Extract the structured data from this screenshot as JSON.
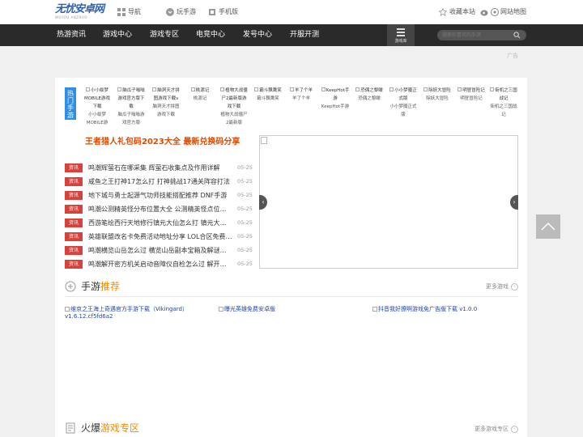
{
  "logo": {
    "main": "无忧安卓网",
    "sub": "WUYOU ANZHUO"
  },
  "toplinks": {
    "nav": "导航",
    "play": "玩手游",
    "phone": "手机版",
    "fav": "收藏本站",
    "sitemap": "网站地图"
  },
  "nav": {
    "items": [
      "热游资讯",
      "游戏中心",
      "游戏专区",
      "电竞中心",
      "发号中心",
      "开服开测"
    ],
    "game_lib": "游戏库"
  },
  "search": {
    "placeholder": "搜索你喜欢的手游"
  },
  "ad_label": "广告",
  "hot": {
    "tag": "热门手游",
    "items": [
      {
        "t1": "小小蚁梦MOBILE游戏下载",
        "t2": "小小蚁梦MOBILE游"
      },
      {
        "t1": "脑瓜子嗡嗡游戏官方版下载",
        "t2": "脑瓜子嗡嗡游戏官方版"
      },
      {
        "t1": "脑洞天才拼图游戏下载v",
        "t2": "脑洞天才拼图游戏下载"
      },
      {
        "t1": "桃源记",
        "t2": "桃源记"
      },
      {
        "t1": "植物大战僵尸2最新版游戏下载",
        "t2": "植物大战僵尸2最新版"
      },
      {
        "t1": "霸斗飘鹰笑",
        "t2": "霸斗飘鹰笑"
      },
      {
        "t1": "羊了个羊",
        "t2": "羊了个羊"
      },
      {
        "t1": "KeepHot手游",
        "t2": "KeepHot手游"
      },
      {
        "t1": "恐偶之黎瞰",
        "t2": "恐偶之黎瞰"
      },
      {
        "t1": "小小梦魇正式版",
        "t2": "小小梦魇正式版"
      },
      {
        "t1": "除妖大冒险",
        "t2": "除妖大冒险"
      },
      {
        "t1": "明昼冒险记",
        "t2": "明昼冒险记"
      },
      {
        "t1": "街机之三国战记",
        "t2": "街机之三国战记"
      }
    ]
  },
  "headline": "王者猎人礼包码2023大全 最新兑换码分享",
  "news": [
    {
      "tag": "资讯",
      "title": "鸣潮辉萤石在哪采集 辉萤石收集点及作用详解",
      "date": "05-25"
    },
    {
      "tag": "资讯",
      "title": "咸鱼之王打神17怎么打 打神挑战17通关阵容打法",
      "date": "05-25"
    },
    {
      "tag": "资讯",
      "title": "地下城与勇士起源气功师技能搭配推荐 DNF手游",
      "date": "05-25"
    },
    {
      "tag": "资讯",
      "title": "鸣潮公测精英怪分布位置大全 公测精英怪点位一览",
      "date": "05-25"
    },
    {
      "tag": "资讯",
      "title": "西游笔绘西行天地修行镇元大仙怎么打 镇元大仙打法",
      "date": "05-25"
    },
    {
      "tag": "资讯",
      "title": "英雄联盟改名卡免费活动地址分享 LOL合区免费改名",
      "date": "05-25"
    },
    {
      "tag": "资讯",
      "title": "鸣潮横览山岳怎么过 横览山岳副本宝箱及解谜攻略",
      "date": "05-25"
    },
    {
      "tag": "资讯",
      "title": "鸣潮解开密方机关启动音障仪自检怎么过 解开密方",
      "date": "05-25"
    }
  ],
  "section1": {
    "pre": "手游",
    "hl": "推荐",
    "more": "更多游戏"
  },
  "recommend": [
    "维京之王海上奇遇官方手游下载（Vikingard）v1.6.12.cf5fd6a2",
    "曝光英雄免费安卓版",
    "抖音我好撩啊游戏免广告版下载 v1.0.0"
  ],
  "section2": {
    "pre": "火爆",
    "hl": "游戏专区",
    "more": "更多游戏专区"
  },
  "slider_arrows": {
    "left": "‹",
    "right": "›"
  }
}
